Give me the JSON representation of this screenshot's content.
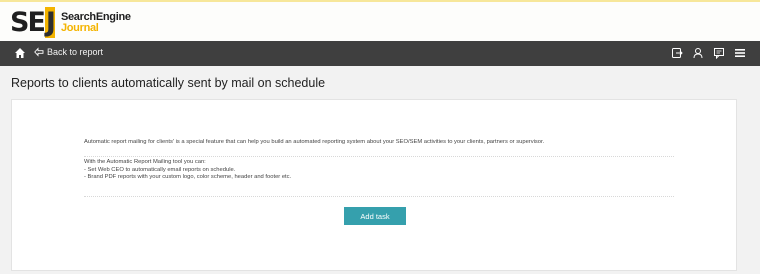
{
  "brand": {
    "short": "SE",
    "j": "J",
    "line1": "SearchEngine",
    "line2": "Journal"
  },
  "nav": {
    "back_label": "Back to report",
    "icons": [
      "home-icon",
      "export-icon",
      "share-icon",
      "flag-icon",
      "menu-icon"
    ]
  },
  "page": {
    "title": "Reports to clients automatically sent by mail on schedule"
  },
  "content": {
    "intro": "Automatic report mailing for clients' is a special feature that can help you build an automated reporting system about your SEO/SEM activities to your clients, partners or supervisor.",
    "features_heading": "With the Automatic Report Mailing tool you can:",
    "features": [
      "- Set Web CEO to automatically email reports on schedule.",
      "- Brand PDF reports with your custom logo, color scheme, header and footer etc."
    ],
    "button_label": "Add task"
  },
  "colors": {
    "nav_bg": "#3f3f3f",
    "accent": "#35a0ad",
    "brand_yellow": "#f4b400"
  }
}
